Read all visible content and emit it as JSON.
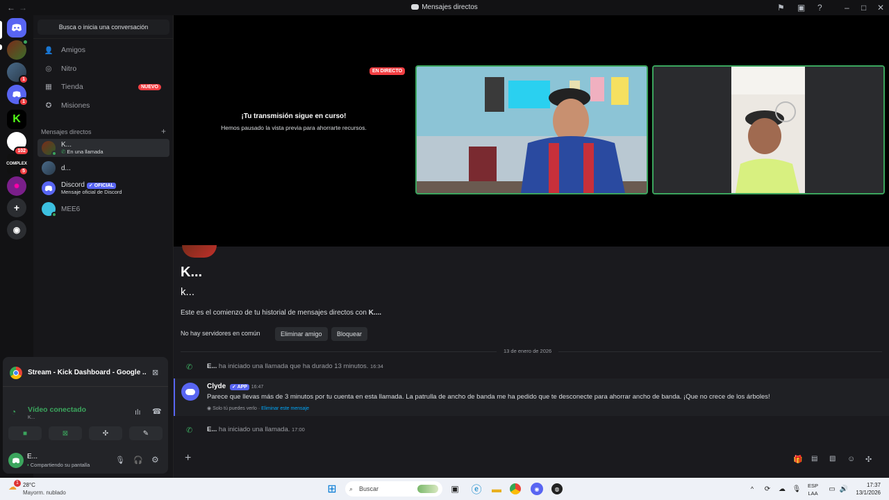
{
  "window": {
    "title": "Mensajes directos",
    "back": "←",
    "forward": "→"
  },
  "guilds": {
    "badges": [
      "1",
      "1",
      "102",
      "5"
    ],
    "complex_label": "COMPLEX"
  },
  "sidebar": {
    "search_label": "Busca o inicia una conversación",
    "nav": [
      {
        "label": "Amigos",
        "icon": "friends-icon"
      },
      {
        "label": "Nitro",
        "icon": "nitro-icon"
      },
      {
        "label": "Tienda",
        "icon": "shop-icon",
        "badge": "NUEVO"
      },
      {
        "label": "Misiones",
        "icon": "quests-icon"
      }
    ],
    "dm_header": "Mensajes directos",
    "dm_add": "+",
    "dms": [
      {
        "name": "K...",
        "sub": "En una llamada"
      },
      {
        "name": "d...",
        "sub": ""
      },
      {
        "name": "Discord",
        "badge": "OFICIAL",
        "sub": "Mensaje oficial de Discord"
      },
      {
        "name": "MEE6",
        "sub": ""
      }
    ]
  },
  "voice": {
    "stream_title": "Stream - Kick Dashboard - Google ...",
    "status": "Vídeo conectado",
    "channel": "K...",
    "user_name": "E...",
    "user_status": "Compartiendo su pantalla"
  },
  "stage": {
    "live_badge": "EN DIRECTO",
    "paused_title": "¡Tu transmisión sigue en curso!",
    "paused_sub": "Hemos pausado la vista previa para ahorrarte recursos."
  },
  "chat": {
    "header_name": "K...",
    "header_user": "k...",
    "intro_prefix": "Este es el comienzo de tu historial de mensajes directos con ",
    "intro_name": "K....",
    "no_servers": "No hay servidores en común",
    "remove_friend": "Eliminar amigo",
    "block": "Bloquear",
    "date_divider": "13 de enero de 2026",
    "call1_user": "E...",
    "call1_text": "ha iniciado una llamada que ha durado 13 minutos.",
    "call1_time": "16:34",
    "clyde_name": "Clyde",
    "clyde_tag": "APP",
    "clyde_time": "16:47",
    "clyde_msg": "Parece que llevas más de 3 minutos por tu cuenta en esta llamada. La patrulla de ancho de banda me ha pedido que te desconecte para ahorrar ancho de banda. ¡Que no crece de los árboles!",
    "clyde_note": "Solo tú puedes verlo · ",
    "clyde_delete": "Eliminar este mensaje",
    "call2_user": "E...",
    "call2_text": "ha iniciado una llamada.",
    "call2_time": "17:00"
  },
  "taskbar": {
    "weather_temp": "28°C",
    "weather_desc": "Mayorm. nublado",
    "weather_badge": "1",
    "search_label": "Buscar",
    "lang": "ESP",
    "lang2": "LAA",
    "time": "17:37",
    "date": "13/1/2026"
  }
}
